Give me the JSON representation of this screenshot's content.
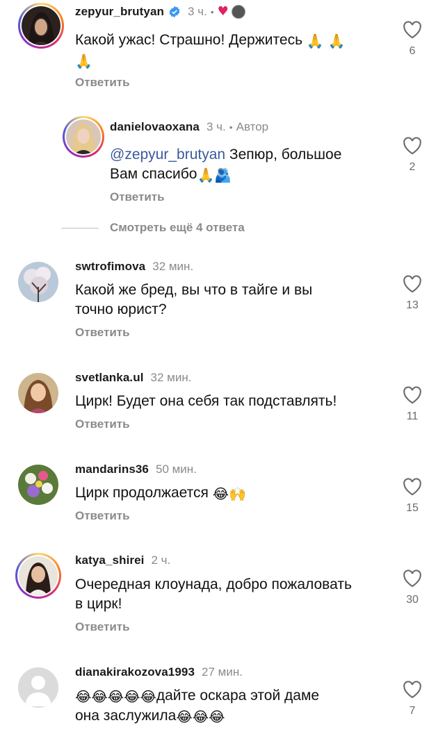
{
  "comments": [
    {
      "username": "zepyur_brutyan",
      "time": "3 ч.",
      "text": "Какой ужас! Страшно! Держитесь",
      "emoji": [
        "🙏",
        "🙏",
        "🙏"
      ],
      "reply_label": "Ответить",
      "likes": "6",
      "avatar_icon": "woman-dark-hair-photo"
    },
    {
      "username": "danielovaoxana",
      "time": "3 ч.",
      "author_label": "Автор",
      "mention": "@zepyur_brutyan",
      "text_line1": " Зепюр, большое",
      "text_line2": "Вам спасибо",
      "emoji": [
        "🙏",
        "🫂"
      ],
      "reply_label": "Ответить",
      "likes": "2",
      "avatar_icon": "woman-blonde-photo"
    },
    {
      "username": "swtrofimova",
      "time": "32 мин.",
      "text_line1": "Какой же бред, вы что в тайге и вы",
      "text_line2": "точно юрист?",
      "reply_label": "Ответить",
      "likes": "13",
      "avatar_icon": "blossom-tree-photo"
    },
    {
      "username": "svetlanka.ul",
      "time": "32 мин.",
      "text": "Цирк! Будет она себя так подставлять!",
      "reply_label": "Ответить",
      "likes": "11",
      "avatar_icon": "cartoon-girl-photo"
    },
    {
      "username": "mandarins36",
      "time": "50 мин.",
      "text": "Цирк продолжается",
      "emoji": [
        "😂",
        "🙌"
      ],
      "reply_label": "Ответить",
      "likes": "15",
      "avatar_icon": "flowers-photo"
    },
    {
      "username": "katya_shirei",
      "time": "2 ч.",
      "text_line1": "Очередная клоунада, добро пожаловать",
      "text_line2": "в цирк!",
      "reply_label": "Ответить",
      "likes": "30",
      "avatar_icon": "woman-smiling-photo"
    },
    {
      "username": "dianakirakozova1993",
      "time": "27 мин.",
      "emoji_lead": [
        "😂",
        "😂",
        "😂",
        "😂",
        "😂"
      ],
      "text_line1": "дайте оскара этой даме",
      "text_line2": "она заслужила",
      "emoji_tail": [
        "😂",
        "😂",
        "😂"
      ],
      "likes": "7",
      "avatar_icon": "default-avatar"
    }
  ],
  "more_replies_label": "Смотреть ещё 4 ответа",
  "colors": {
    "text": "#111111",
    "muted": "#8a8a8a",
    "mention": "#3b5a9a",
    "verified": "#3897f0",
    "heart": "#e0245e"
  }
}
